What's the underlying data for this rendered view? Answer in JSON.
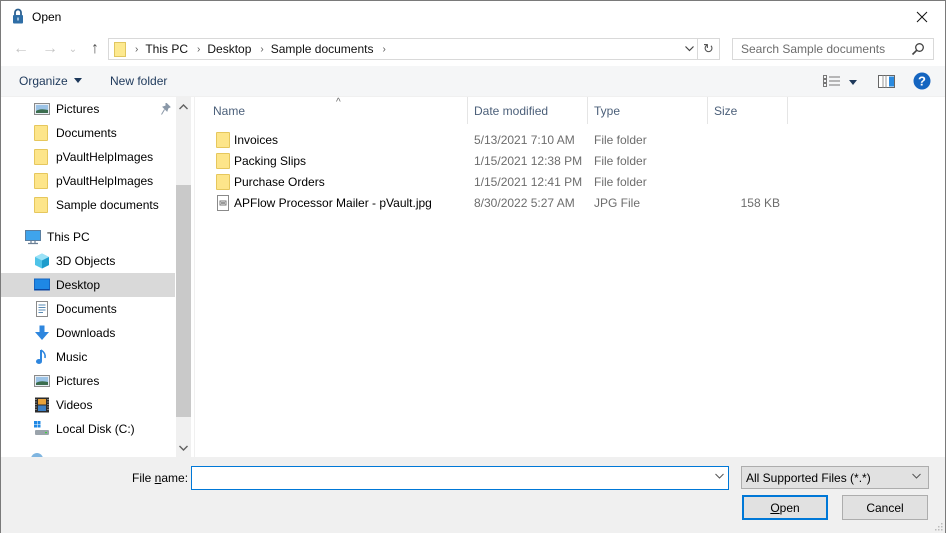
{
  "window": {
    "title": "Open",
    "close_label": "×"
  },
  "nav": {
    "back_icon": "←",
    "forward_icon": "→",
    "recent_icon": "⌄",
    "up_icon": "↑",
    "breadcrumbs": [
      "This PC",
      "Desktop",
      "Sample documents"
    ],
    "crumb_sep": "›",
    "address_dropdown_icon": "⌄",
    "refresh_icon": "↻",
    "search_placeholder": "Search Sample documents"
  },
  "toolbar": {
    "organize_label": "Organize",
    "new_folder_label": "New folder"
  },
  "sidebar": {
    "quick_access": [
      {
        "label": "Pictures",
        "icon": "pictures-icon",
        "pinned": true
      },
      {
        "label": "Documents",
        "icon": "folder-icon"
      },
      {
        "label": "pVaultHelpImages",
        "icon": "folder-icon"
      },
      {
        "label": "pVaultHelpImages",
        "icon": "folder-icon"
      },
      {
        "label": "Sample documents",
        "icon": "folder-icon"
      }
    ],
    "this_pc_label": "This PC",
    "this_pc_items": [
      {
        "label": "3D Objects",
        "icon": "3d-objects-icon"
      },
      {
        "label": "Desktop",
        "icon": "desktop-icon",
        "selected": true
      },
      {
        "label": "Documents",
        "icon": "documents-icon"
      },
      {
        "label": "Downloads",
        "icon": "downloads-icon"
      },
      {
        "label": "Music",
        "icon": "music-icon"
      },
      {
        "label": "Pictures",
        "icon": "pictures-icon"
      },
      {
        "label": "Videos",
        "icon": "videos-icon"
      },
      {
        "label": "Local Disk (C:)",
        "icon": "local-disk-icon"
      }
    ],
    "scroll_up_icon": "^",
    "scroll_down_icon": "v"
  },
  "file_list": {
    "columns": [
      "Name",
      "Date modified",
      "Type",
      "Size"
    ],
    "sort_indicator": "^",
    "rows": [
      {
        "name": "Invoices",
        "date": "5/13/2021 7:10 AM",
        "type": "File folder",
        "size": "",
        "kind": "folder"
      },
      {
        "name": "Packing Slips",
        "date": "1/15/2021 12:38 PM",
        "type": "File folder",
        "size": "",
        "kind": "folder"
      },
      {
        "name": "Purchase Orders",
        "date": "1/15/2021 12:41 PM",
        "type": "File folder",
        "size": "",
        "kind": "folder"
      },
      {
        "name": "APFlow Processor Mailer - pVault.jpg",
        "date": "8/30/2022 5:27 AM",
        "type": "JPG File",
        "size": "158 KB",
        "kind": "image"
      }
    ]
  },
  "footer": {
    "file_name_label_pre": "File ",
    "file_name_label_mnemonic": "n",
    "file_name_label_post": "ame:",
    "file_name_value": "",
    "file_type_selected": "All Supported Files (*.*)",
    "open_mnemonic": "O",
    "open_rest": "pen",
    "cancel_label": "Cancel"
  },
  "colors": {
    "accent": "#0078d7",
    "selected_bg": "#d9d9d9",
    "help_blue": "#1565c0"
  }
}
